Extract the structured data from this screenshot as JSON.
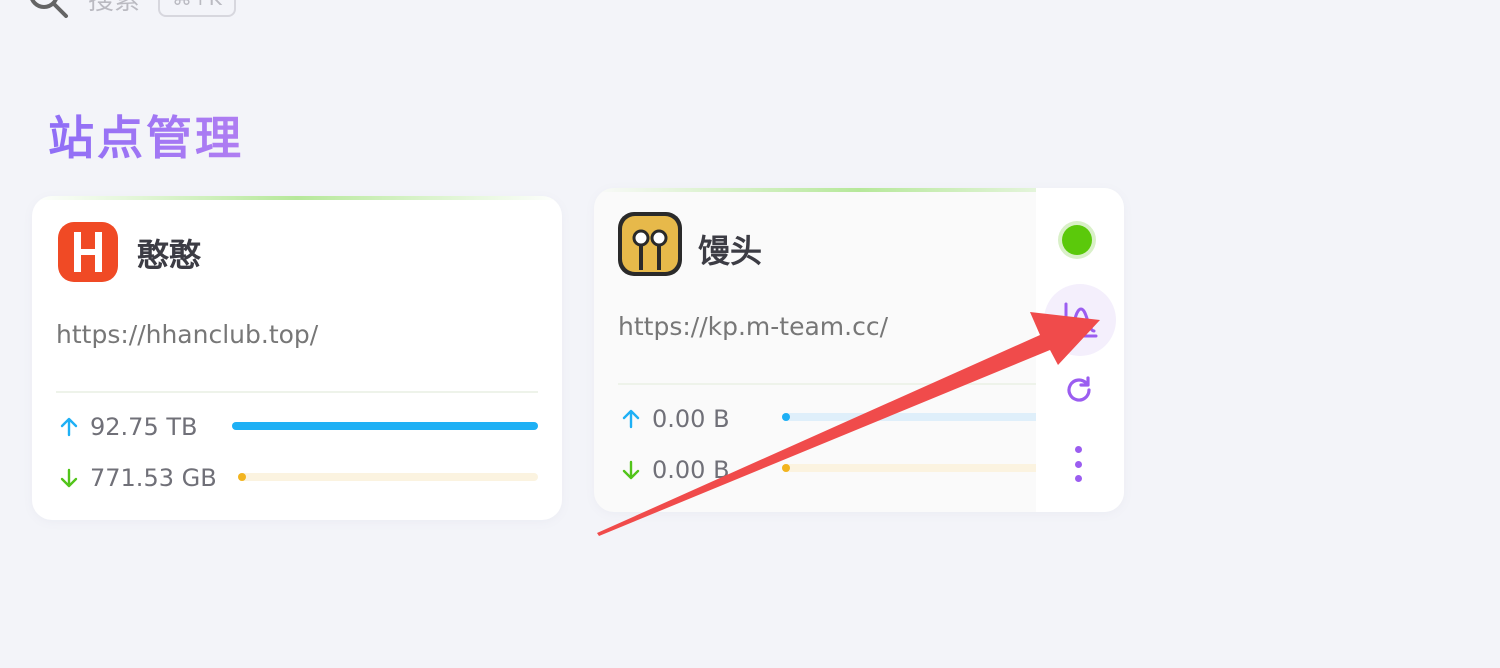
{
  "search": {
    "label": "搜索",
    "shortcut": "⌘+K"
  },
  "page": {
    "title": "站点管理"
  },
  "sites": [
    {
      "name": "憨憨",
      "url": "https://hhanclub.top/",
      "upload": "92.75 TB",
      "download": "771.53 GB",
      "upload_ratio": 1.0,
      "download_ratio": 0.02
    },
    {
      "name": "馒头",
      "url": "https://kp.m-team.cc/",
      "upload": "0.00 B",
      "download": "0.00 B",
      "upload_ratio": 0.01,
      "download_ratio": 0.01
    }
  ],
  "colors": {
    "accent": "#9b5df0",
    "upload": "#1eb0f5",
    "download": "#f2b41f",
    "download_arrow": "#52c41a",
    "status_online": "#5bc90b",
    "annotation": "#f04b4b"
  },
  "icons": [
    "search-icon",
    "upload-arrow-icon",
    "download-arrow-icon",
    "chart-icon",
    "refresh-icon",
    "more-icon"
  ]
}
